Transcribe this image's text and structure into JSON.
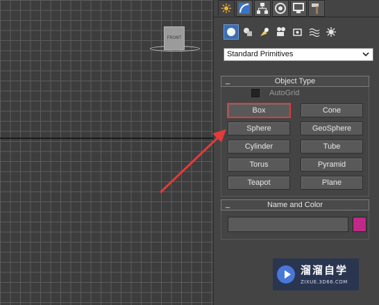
{
  "viewport": {
    "viewcube_label": "FRONT"
  },
  "command_panel": {
    "tabs": [
      {
        "icon": "create-icon",
        "active": true
      },
      {
        "icon": "modify-icon",
        "active": false
      },
      {
        "icon": "hierarchy-icon",
        "active": false
      },
      {
        "icon": "motion-icon",
        "active": false
      },
      {
        "icon": "display-icon",
        "active": false
      },
      {
        "icon": "utilities-icon",
        "active": false
      }
    ],
    "categories": [
      {
        "icon": "geometry-icon",
        "active": true
      },
      {
        "icon": "shapes-icon",
        "active": false
      },
      {
        "icon": "lights-icon",
        "active": false
      },
      {
        "icon": "cameras-icon",
        "active": false
      },
      {
        "icon": "helpers-icon",
        "active": false
      },
      {
        "icon": "space-warps-icon",
        "active": false
      },
      {
        "icon": "systems-icon",
        "active": false
      }
    ],
    "dropdown_value": "Standard Primitives",
    "object_type": {
      "title": "Object Type",
      "collapse": "_",
      "autogrid_label": "AutoGrid",
      "autogrid_checked": false,
      "buttons": [
        "Box",
        "Cone",
        "Sphere",
        "GeoSphere",
        "Cylinder",
        "Tube",
        "Torus",
        "Pyramid",
        "Teapot",
        "Plane"
      ],
      "highlighted": "Box"
    },
    "name_and_color": {
      "title": "Name and Color",
      "collapse": "_",
      "name_value": "",
      "color": "#c02a86"
    }
  },
  "watermark": {
    "title": "溜溜自学",
    "url": "ZIXUE.3D66.COM"
  },
  "colors": {
    "highlight_border": "#e03a3a",
    "annotation_arrow": "#e33b3b",
    "active_category": "#3d6fb0"
  }
}
